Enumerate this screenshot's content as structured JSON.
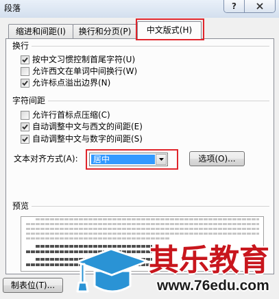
{
  "window": {
    "title": "段落",
    "help_label": "?",
    "help_icon": "help-icon",
    "close_icon": "close-icon"
  },
  "tabs": [
    {
      "label": "缩进和间距(I)",
      "selected": false
    },
    {
      "label": "换行和分页(P)",
      "selected": false
    },
    {
      "label": "中文版式(H)",
      "selected": true
    }
  ],
  "line_breaking": {
    "heading": "换行",
    "options": [
      {
        "label": "按中文习惯控制首尾字符(U)",
        "checked": true
      },
      {
        "label": "允许西文在单词中间换行(W)",
        "checked": false
      },
      {
        "label": "允许标点溢出边界(N)",
        "checked": true
      }
    ]
  },
  "character_spacing": {
    "heading": "字符间距",
    "options": [
      {
        "label": "允许行首标点压缩(C)",
        "checked": false
      },
      {
        "label": "自动调整中文与西文的间距(E)",
        "checked": true
      },
      {
        "label": "自动调整中文与数字的间距(S)",
        "checked": true
      }
    ],
    "alignment_label": "文本对齐方式(A):",
    "alignment_value": "居中",
    "alignment_arrow_icon": "chevron-down-icon",
    "options_button": "选项(O)..."
  },
  "preview": {
    "heading": "预览"
  },
  "footer": {
    "tabs_button": "制表位(T)..."
  },
  "watermark": {
    "logo_icon": "graduation-cap-icon",
    "brand": "其乐教育",
    "url": "www.76edu.com"
  },
  "icons": {
    "checkmark": "checkmark-icon"
  },
  "colors": {
    "annotation": "#e0242b",
    "selection": "#3399ff",
    "watermark_red": "#c8161d",
    "watermark_blue": "#2a93d5"
  }
}
